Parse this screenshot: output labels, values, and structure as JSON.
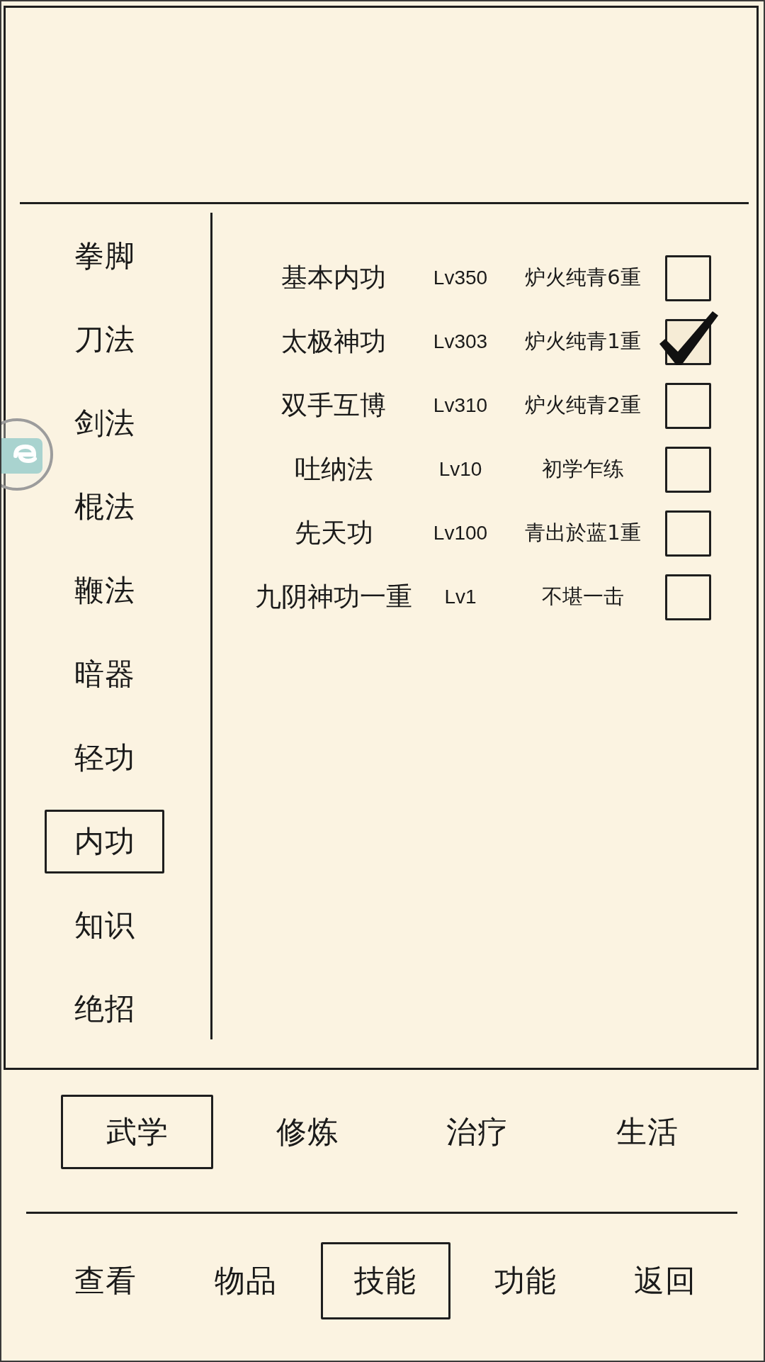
{
  "categories": [
    {
      "label": "拳脚",
      "selected": false
    },
    {
      "label": "刀法",
      "selected": false
    },
    {
      "label": "剑法",
      "selected": false
    },
    {
      "label": "棍法",
      "selected": false
    },
    {
      "label": "鞭法",
      "selected": false
    },
    {
      "label": "暗器",
      "selected": false
    },
    {
      "label": "轻功",
      "selected": false
    },
    {
      "label": "内功",
      "selected": true
    },
    {
      "label": "知识",
      "selected": false
    },
    {
      "label": "绝招",
      "selected": false
    }
  ],
  "skills": [
    {
      "name": "基本内功",
      "grade": "Lv350",
      "realm": "炉火纯青6重",
      "checked": false
    },
    {
      "name": "太极神功",
      "grade": "Lv303",
      "realm": "炉火纯青1重",
      "checked": true
    },
    {
      "name": "双手互博",
      "grade": "Lv310",
      "realm": "炉火纯青2重",
      "checked": false
    },
    {
      "name": "吐纳法",
      "grade": "Lv10",
      "realm": "初学乍练",
      "checked": false
    },
    {
      "name": "先天功",
      "grade": "Lv100",
      "realm": "青出於蓝1重",
      "checked": false
    },
    {
      "name": "九阴神功一重",
      "grade": "Lv1",
      "realm": "不堪一击",
      "checked": false
    }
  ],
  "skill_tabs": [
    {
      "label": "武学",
      "selected": true
    },
    {
      "label": "修炼",
      "selected": false
    },
    {
      "label": "治疗",
      "selected": false
    },
    {
      "label": "生活",
      "selected": false
    }
  ],
  "nav": [
    {
      "label": "查看",
      "selected": false
    },
    {
      "label": "物品",
      "selected": false
    },
    {
      "label": "技能",
      "selected": true
    },
    {
      "label": "功能",
      "selected": false
    },
    {
      "label": "返回",
      "selected": false
    }
  ]
}
